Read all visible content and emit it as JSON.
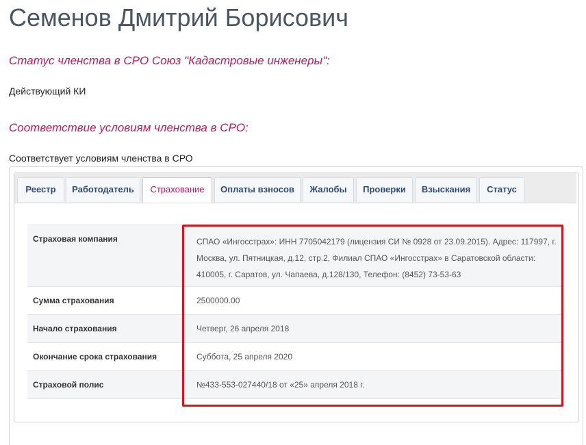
{
  "header": {
    "person_name": "Семенов Дмитрий Борисович"
  },
  "membership_status": {
    "heading": "Статус членства в СРО Союз \"Кадастровые инженеры\":",
    "value": "Действующий КИ"
  },
  "compliance": {
    "heading": "Соответствие условиям членства в СРО:",
    "value": "Соответствует условиям членства в СРО"
  },
  "tabs": [
    {
      "label": "Реестр",
      "active": false
    },
    {
      "label": "Работодатель",
      "active": false
    },
    {
      "label": "Страхование",
      "active": true
    },
    {
      "label": "Оплаты взносов",
      "active": false
    },
    {
      "label": "Жалобы",
      "active": false
    },
    {
      "label": "Проверки",
      "active": false
    },
    {
      "label": "Взыскания",
      "active": false
    },
    {
      "label": "Статус",
      "active": false
    }
  ],
  "insurance": {
    "rows": [
      {
        "label": "Страховая компания",
        "value_lines": [
          "СПАО «Ингосстрах»: ИНН 7705042179 (лицензия СИ № 0928 от 23.09.2015). Адрес: 117997, г.",
          "Москва, ул. Пятницкая, д.12, стр.2, Филиал СПАО «Ингосстрах» в Саратовской области:",
          "410005, г. Саратов, ул. Чапаева, д.128/130, Телефон: (8452) 73-53-63"
        ]
      },
      {
        "label": "Сумма страхования",
        "value": "2500000.00"
      },
      {
        "label": "Начало страхования",
        "value": "Четверг, 26 апреля 2018"
      },
      {
        "label": "Окончание срока страхования",
        "value": "Суббота, 25 апреля 2020"
      },
      {
        "label": "Страховой полис",
        "value": "№433-553-027440/18 от «25» апреля 2018 г."
      }
    ]
  },
  "colors": {
    "heading_accent": "#c2185b",
    "tab_text": "#2f4a7a",
    "highlight": "#e0101a"
  }
}
